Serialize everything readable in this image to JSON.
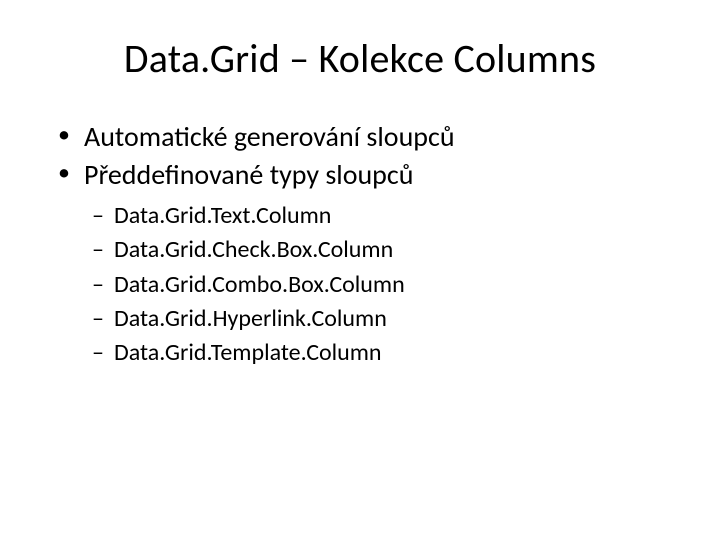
{
  "slide": {
    "title": "Data.Grid – Kolekce Columns",
    "bullets": [
      {
        "text": "Automatické generování sloupců"
      },
      {
        "text": "Předdefinované typy sloupců"
      }
    ],
    "sub_bullets": [
      {
        "text": "Data.Grid.Text.Column"
      },
      {
        "text": "Data.Grid.Check.Box.Column"
      },
      {
        "text": "Data.Grid.Combo.Box.Column"
      },
      {
        "text": "Data.Grid.Hyperlink.Column"
      },
      {
        "text": "Data.Grid.Template.Column"
      }
    ]
  }
}
